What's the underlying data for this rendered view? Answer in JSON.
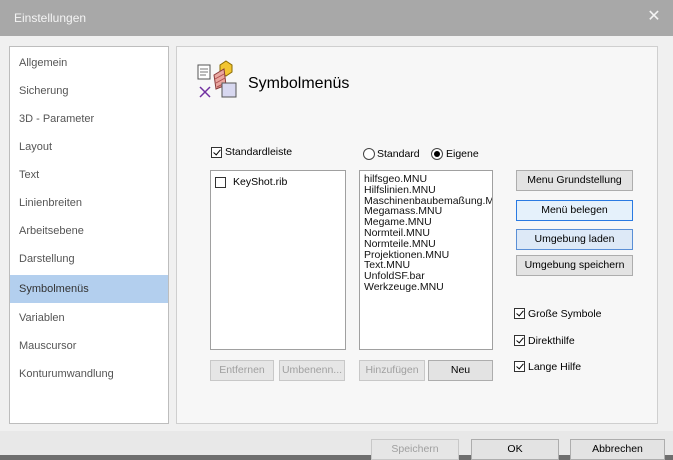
{
  "window": {
    "title": "Einstellungen",
    "close_icon": "close-icon"
  },
  "sidebar": {
    "items": [
      {
        "label": "Allgemein",
        "selected": false
      },
      {
        "label": "Sicherung",
        "selected": false
      },
      {
        "label": "3D - Parameter",
        "selected": false
      },
      {
        "label": "Layout",
        "selected": false
      },
      {
        "label": "Text",
        "selected": false
      },
      {
        "label": "Linienbreiten",
        "selected": false
      },
      {
        "label": "Arbeitsebene",
        "selected": false
      },
      {
        "label": "Darstellung",
        "selected": false
      },
      {
        "label": "Symbolmenüs",
        "selected": true
      },
      {
        "label": "Variablen",
        "selected": false
      },
      {
        "label": "Mauscursor",
        "selected": false
      },
      {
        "label": "Konturumwandlung",
        "selected": false
      }
    ]
  },
  "panel": {
    "title": "Symbolmenüs",
    "header_icon": "symbol-menus-icon",
    "standardleiste": {
      "label": "Standardleiste",
      "checked": true
    },
    "radio": {
      "standard": {
        "label": "Standard",
        "checked": false
      },
      "eigene": {
        "label": "Eigene",
        "checked": true
      }
    },
    "left_list": [
      {
        "label": "KeyShot.rib",
        "checked": false
      }
    ],
    "right_list": [
      "hilfsgeo.MNU",
      "Hilfslinien.MNU",
      "Maschinenbaubemaßung.MNU",
      "Megamass.MNU",
      "Megame.MNU",
      "Normteil.MNU",
      "Normteile.MNU",
      "Projektionen.MNU",
      "Text.MNU",
      "UnfoldSF.bar",
      "Werkzeuge.MNU"
    ],
    "buttons": {
      "entfernen": "Entfernen",
      "umbenennen": "Umbenenn...",
      "hinzufuegen": "Hinzufügen",
      "neu": "Neu",
      "menu_grundstellung": "Menu Grundstellung",
      "menu_belegen": "Menü belegen",
      "umgebung_laden": "Umgebung laden",
      "umgebung_speichern": "Umgebung speichern"
    },
    "options": {
      "grosse_symbole": {
        "label": "Große Symbole",
        "checked": true
      },
      "direkthilfe": {
        "label": "Direkthilfe",
        "checked": true
      },
      "lange_hilfe": {
        "label": "Lange Hilfe",
        "checked": true
      }
    }
  },
  "footer": {
    "speichern": "Speichern",
    "ok": "OK",
    "abbrechen": "Abbrechen"
  },
  "colors": {
    "selection": "#b3cfee",
    "titlebar": "#a8a8a8",
    "focus_border": "#2a7ae2"
  }
}
